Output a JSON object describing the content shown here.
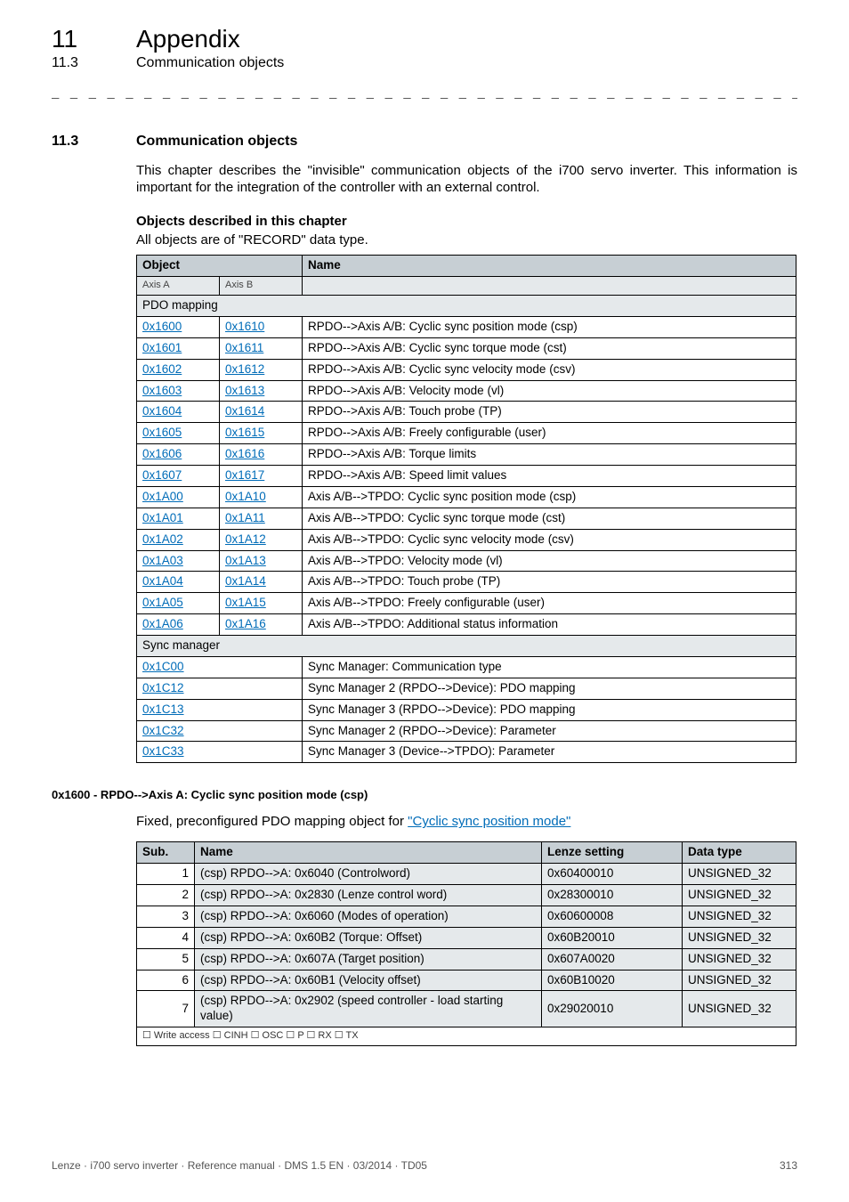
{
  "header": {
    "chapter_num": "11",
    "chapter_title": "Appendix",
    "section_num": "11.3",
    "section_title": "Communication objects"
  },
  "sec_heading": {
    "num": "11.3",
    "title": "Communication objects"
  },
  "intro_text": "This chapter describes the \"invisible\" communication objects of the i700 servo inverter. This information is important for the integration of the controller with an external control.",
  "objects_heading": "Objects described in this chapter",
  "objects_note": "All objects are of \"RECORD\" data type.",
  "table1": {
    "head_object": "Object",
    "head_name": "Name",
    "sub_axis_a": "Axis A",
    "sub_axis_b": "Axis B",
    "section_pdo": "PDO mapping",
    "section_sync": "Sync manager",
    "rows": [
      {
        "a": "0x1600",
        "b": "0x1610",
        "name": "RPDO-->Axis A/B: Cyclic sync position mode (csp)"
      },
      {
        "a": "0x1601",
        "b": "0x1611",
        "name": "RPDO-->Axis A/B: Cyclic sync torque mode (cst)"
      },
      {
        "a": "0x1602",
        "b": "0x1612",
        "name": "RPDO-->Axis A/B: Cyclic sync velocity mode (csv)"
      },
      {
        "a": "0x1603",
        "b": "0x1613",
        "name": "RPDO-->Axis A/B: Velocity mode (vl)"
      },
      {
        "a": "0x1604",
        "b": "0x1614",
        "name": "RPDO-->Axis A/B: Touch probe (TP)"
      },
      {
        "a": "0x1605",
        "b": "0x1615",
        "name": "RPDO-->Axis A/B: Freely configurable (user)"
      },
      {
        "a": "0x1606",
        "b": "0x1616",
        "name": "RPDO-->Axis A/B: Torque limits"
      },
      {
        "a": "0x1607",
        "b": "0x1617",
        "name": "RPDO-->Axis A/B: Speed limit values"
      },
      {
        "a": "0x1A00",
        "b": "0x1A10",
        "name": "Axis A/B-->TPDO: Cyclic sync position mode (csp)"
      },
      {
        "a": "0x1A01",
        "b": "0x1A11",
        "name": "Axis A/B-->TPDO: Cyclic sync torque mode (cst)"
      },
      {
        "a": "0x1A02",
        "b": "0x1A12",
        "name": "Axis A/B-->TPDO: Cyclic sync velocity mode (csv)"
      },
      {
        "a": "0x1A03",
        "b": "0x1A13",
        "name": "Axis A/B-->TPDO: Velocity mode (vl)"
      },
      {
        "a": "0x1A04",
        "b": "0x1A14",
        "name": "Axis A/B-->TPDO: Touch probe (TP)"
      },
      {
        "a": "0x1A05",
        "b": "0x1A15",
        "name": "Axis A/B-->TPDO: Freely configurable (user)"
      },
      {
        "a": "0x1A06",
        "b": "0x1A16",
        "name": "Axis A/B-->TPDO: Additional status information"
      }
    ],
    "sync_rows": [
      {
        "a": "0x1C00",
        "name": "Sync Manager: Communication type"
      },
      {
        "a": "0x1C12",
        "name": "Sync Manager 2 (RPDO-->Device): PDO mapping"
      },
      {
        "a": "0x1C13",
        "name": "Sync Manager 3 (RPDO-->Device): PDO mapping"
      },
      {
        "a": "0x1C32",
        "name": "Sync Manager 2 (RPDO-->Device): Parameter"
      },
      {
        "a": "0x1C33",
        "name": "Sync Manager 3 (Device-->TPDO): Parameter"
      }
    ]
  },
  "param": {
    "heading": "0x1600 - RPDO-->Axis A: Cyclic sync position mode (csp)",
    "desc_prefix": "Fixed, preconfigured PDO mapping object for ",
    "desc_link": "\"Cyclic sync position mode\"",
    "head_sub": "Sub.",
    "head_name": "Name",
    "head_lenze": "Lenze setting",
    "head_dtype": "Data type",
    "rows": [
      {
        "sub": "1",
        "name": "(csp) RPDO-->A: 0x6040 (Controlword)",
        "lenze": "0x60400010",
        "dtype": "UNSIGNED_32"
      },
      {
        "sub": "2",
        "name": "(csp) RPDO-->A: 0x2830 (Lenze control word)",
        "lenze": "0x28300010",
        "dtype": "UNSIGNED_32"
      },
      {
        "sub": "3",
        "name": "(csp) RPDO-->A: 0x6060 (Modes of operation)",
        "lenze": "0x60600008",
        "dtype": "UNSIGNED_32"
      },
      {
        "sub": "4",
        "name": "(csp) RPDO-->A: 0x60B2 (Torque: Offset)",
        "lenze": "0x60B20010",
        "dtype": "UNSIGNED_32"
      },
      {
        "sub": "5",
        "name": "(csp) RPDO-->A: 0x607A (Target position)",
        "lenze": "0x607A0020",
        "dtype": "UNSIGNED_32"
      },
      {
        "sub": "6",
        "name": "(csp) RPDO-->A: 0x60B1 (Velocity offset)",
        "lenze": "0x60B10020",
        "dtype": "UNSIGNED_32"
      },
      {
        "sub": "7",
        "name": "(csp) RPDO-->A: 0x2902 (speed controller - load starting value)",
        "lenze": "0x29020010",
        "dtype": "UNSIGNED_32"
      }
    ],
    "footer": "☐ Write access   ☐ CINH   ☐ OSC   ☐ P   ☐ RX   ☐ TX"
  },
  "footer": {
    "left": "Lenze · i700 servo inverter · Reference manual · DMS 1.5 EN · 03/2014 · TD05",
    "right": "313"
  },
  "dashrule": "_ _ _ _ _ _ _ _ _ _ _ _ _ _ _ _ _ _ _ _ _ _ _ _ _ _ _ _ _ _ _ _ _ _ _ _ _ _ _ _ _ _ _ _ _ _ _ _ _ _ _ _ _ _ _ _ _ _ _ _ _ _ _ _"
}
